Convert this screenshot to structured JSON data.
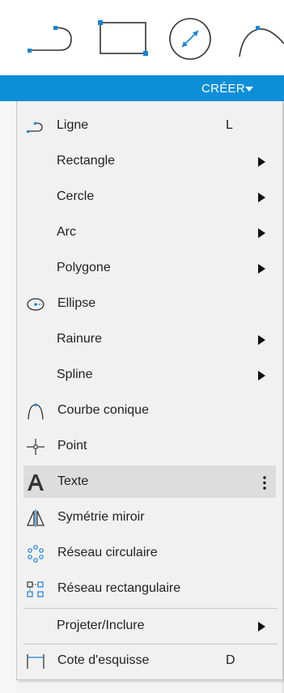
{
  "toolbar": {
    "tools": [
      {
        "icon": "line-icon"
      },
      {
        "icon": "rectangle-icon"
      },
      {
        "icon": "circle-diameter-icon"
      },
      {
        "icon": "spline-icon"
      }
    ]
  },
  "create_menu": {
    "label": "CRÉER",
    "accent_color": "#0d8fd8",
    "items": [
      {
        "label": "Ligne",
        "shortcut": "L",
        "icon": "line-icon"
      },
      {
        "label": "Rectangle",
        "submenu": true
      },
      {
        "label": "Cercle",
        "submenu": true
      },
      {
        "label": "Arc",
        "submenu": true
      },
      {
        "label": "Polygone",
        "submenu": true
      },
      {
        "label": "Ellipse",
        "icon": "ellipse-icon"
      },
      {
        "label": "Rainure",
        "submenu": true
      },
      {
        "label": "Spline",
        "submenu": true
      },
      {
        "label": "Courbe conique",
        "icon": "conic-curve-icon"
      },
      {
        "label": "Point",
        "icon": "point-icon"
      },
      {
        "label": "Texte",
        "icon": "text-icon",
        "highlighted": true,
        "more": true
      },
      {
        "label": "Symétrie miroir",
        "icon": "mirror-icon"
      },
      {
        "label": "Réseau circulaire",
        "icon": "circular-pattern-icon"
      },
      {
        "label": "Réseau rectangulaire",
        "icon": "rectangular-pattern-icon"
      },
      {
        "label": "Projeter/Inclure",
        "submenu": true
      },
      {
        "label": "Cote d'esquisse",
        "shortcut": "D",
        "icon": "sketch-dimension-icon"
      }
    ]
  }
}
